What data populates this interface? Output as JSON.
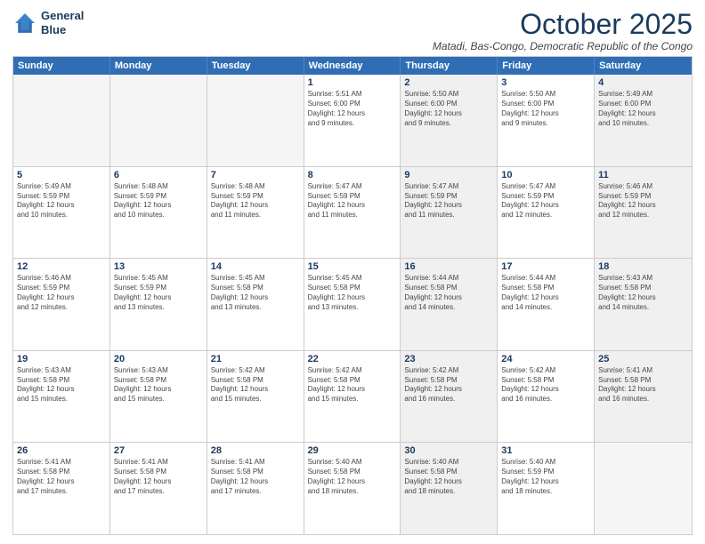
{
  "logo": {
    "line1": "General",
    "line2": "Blue"
  },
  "title": "October 2025",
  "subtitle": "Matadi, Bas-Congo, Democratic Republic of the Congo",
  "days_of_week": [
    "Sunday",
    "Monday",
    "Tuesday",
    "Wednesday",
    "Thursday",
    "Friday",
    "Saturday"
  ],
  "rows": [
    [
      {
        "day": "",
        "info": "",
        "empty": true
      },
      {
        "day": "",
        "info": "",
        "empty": true
      },
      {
        "day": "",
        "info": "",
        "empty": true
      },
      {
        "day": "1",
        "info": "Sunrise: 5:51 AM\nSunset: 6:00 PM\nDaylight: 12 hours\nand 9 minutes.",
        "shaded": false
      },
      {
        "day": "2",
        "info": "Sunrise: 5:50 AM\nSunset: 6:00 PM\nDaylight: 12 hours\nand 9 minutes.",
        "shaded": true
      },
      {
        "day": "3",
        "info": "Sunrise: 5:50 AM\nSunset: 6:00 PM\nDaylight: 12 hours\nand 9 minutes.",
        "shaded": false
      },
      {
        "day": "4",
        "info": "Sunrise: 5:49 AM\nSunset: 6:00 PM\nDaylight: 12 hours\nand 10 minutes.",
        "shaded": true
      }
    ],
    [
      {
        "day": "5",
        "info": "Sunrise: 5:49 AM\nSunset: 5:59 PM\nDaylight: 12 hours\nand 10 minutes.",
        "shaded": false
      },
      {
        "day": "6",
        "info": "Sunrise: 5:48 AM\nSunset: 5:59 PM\nDaylight: 12 hours\nand 10 minutes.",
        "shaded": false
      },
      {
        "day": "7",
        "info": "Sunrise: 5:48 AM\nSunset: 5:59 PM\nDaylight: 12 hours\nand 11 minutes.",
        "shaded": false
      },
      {
        "day": "8",
        "info": "Sunrise: 5:47 AM\nSunset: 5:59 PM\nDaylight: 12 hours\nand 11 minutes.",
        "shaded": false
      },
      {
        "day": "9",
        "info": "Sunrise: 5:47 AM\nSunset: 5:59 PM\nDaylight: 12 hours\nand 11 minutes.",
        "shaded": true
      },
      {
        "day": "10",
        "info": "Sunrise: 5:47 AM\nSunset: 5:59 PM\nDaylight: 12 hours\nand 12 minutes.",
        "shaded": false
      },
      {
        "day": "11",
        "info": "Sunrise: 5:46 AM\nSunset: 5:59 PM\nDaylight: 12 hours\nand 12 minutes.",
        "shaded": true
      }
    ],
    [
      {
        "day": "12",
        "info": "Sunrise: 5:46 AM\nSunset: 5:59 PM\nDaylight: 12 hours\nand 12 minutes.",
        "shaded": false
      },
      {
        "day": "13",
        "info": "Sunrise: 5:45 AM\nSunset: 5:59 PM\nDaylight: 12 hours\nand 13 minutes.",
        "shaded": false
      },
      {
        "day": "14",
        "info": "Sunrise: 5:45 AM\nSunset: 5:58 PM\nDaylight: 12 hours\nand 13 minutes.",
        "shaded": false
      },
      {
        "day": "15",
        "info": "Sunrise: 5:45 AM\nSunset: 5:58 PM\nDaylight: 12 hours\nand 13 minutes.",
        "shaded": false
      },
      {
        "day": "16",
        "info": "Sunrise: 5:44 AM\nSunset: 5:58 PM\nDaylight: 12 hours\nand 14 minutes.",
        "shaded": true
      },
      {
        "day": "17",
        "info": "Sunrise: 5:44 AM\nSunset: 5:58 PM\nDaylight: 12 hours\nand 14 minutes.",
        "shaded": false
      },
      {
        "day": "18",
        "info": "Sunrise: 5:43 AM\nSunset: 5:58 PM\nDaylight: 12 hours\nand 14 minutes.",
        "shaded": true
      }
    ],
    [
      {
        "day": "19",
        "info": "Sunrise: 5:43 AM\nSunset: 5:58 PM\nDaylight: 12 hours\nand 15 minutes.",
        "shaded": false
      },
      {
        "day": "20",
        "info": "Sunrise: 5:43 AM\nSunset: 5:58 PM\nDaylight: 12 hours\nand 15 minutes.",
        "shaded": false
      },
      {
        "day": "21",
        "info": "Sunrise: 5:42 AM\nSunset: 5:58 PM\nDaylight: 12 hours\nand 15 minutes.",
        "shaded": false
      },
      {
        "day": "22",
        "info": "Sunrise: 5:42 AM\nSunset: 5:58 PM\nDaylight: 12 hours\nand 15 minutes.",
        "shaded": false
      },
      {
        "day": "23",
        "info": "Sunrise: 5:42 AM\nSunset: 5:58 PM\nDaylight: 12 hours\nand 16 minutes.",
        "shaded": true
      },
      {
        "day": "24",
        "info": "Sunrise: 5:42 AM\nSunset: 5:58 PM\nDaylight: 12 hours\nand 16 minutes.",
        "shaded": false
      },
      {
        "day": "25",
        "info": "Sunrise: 5:41 AM\nSunset: 5:58 PM\nDaylight: 12 hours\nand 16 minutes.",
        "shaded": true
      }
    ],
    [
      {
        "day": "26",
        "info": "Sunrise: 5:41 AM\nSunset: 5:58 PM\nDaylight: 12 hours\nand 17 minutes.",
        "shaded": false
      },
      {
        "day": "27",
        "info": "Sunrise: 5:41 AM\nSunset: 5:58 PM\nDaylight: 12 hours\nand 17 minutes.",
        "shaded": false
      },
      {
        "day": "28",
        "info": "Sunrise: 5:41 AM\nSunset: 5:58 PM\nDaylight: 12 hours\nand 17 minutes.",
        "shaded": false
      },
      {
        "day": "29",
        "info": "Sunrise: 5:40 AM\nSunset: 5:58 PM\nDaylight: 12 hours\nand 18 minutes.",
        "shaded": false
      },
      {
        "day": "30",
        "info": "Sunrise: 5:40 AM\nSunset: 5:58 PM\nDaylight: 12 hours\nand 18 minutes.",
        "shaded": true
      },
      {
        "day": "31",
        "info": "Sunrise: 5:40 AM\nSunset: 5:59 PM\nDaylight: 12 hours\nand 18 minutes.",
        "shaded": false
      },
      {
        "day": "",
        "info": "",
        "empty": true
      }
    ]
  ]
}
